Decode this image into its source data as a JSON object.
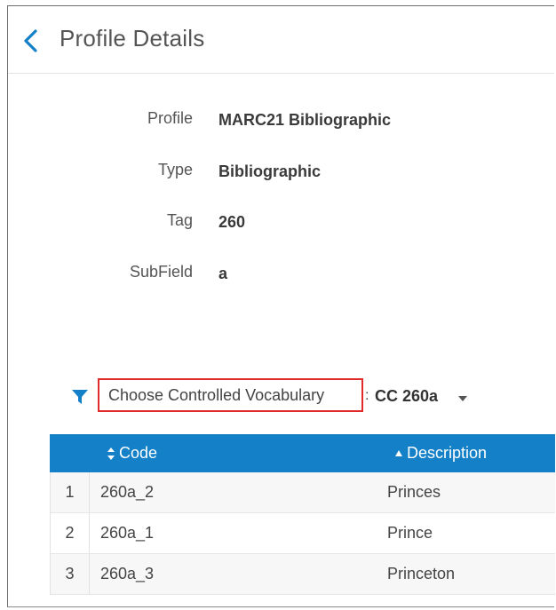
{
  "header": {
    "title": "Profile Details"
  },
  "details": [
    {
      "label": "Profile",
      "value": "MARC21 Bibliographic"
    },
    {
      "label": "Type",
      "value": "Bibliographic"
    },
    {
      "label": "Tag",
      "value": "260"
    },
    {
      "label": "SubField",
      "value": "a"
    }
  ],
  "vocabulary": {
    "label": "Choose Controlled Vocabulary",
    "separator": ":",
    "selected": "CC 260a"
  },
  "table": {
    "columns": [
      "Code",
      "Description"
    ],
    "rows": [
      {
        "num": "1",
        "code": "260a_2",
        "description": "Princes"
      },
      {
        "num": "2",
        "code": "260a_1",
        "description": "Prince"
      },
      {
        "num": "3",
        "code": "260a_3",
        "description": "Princeton"
      }
    ]
  },
  "colors": {
    "accent": "#1380c8",
    "highlight_border": "#e02b2b"
  },
  "icons": {
    "back": "chevron-left-icon",
    "filter": "filter-icon",
    "dropdown": "caret-down-icon",
    "sort_both": "sort-icon",
    "sort_asc": "sort-asc-icon"
  }
}
